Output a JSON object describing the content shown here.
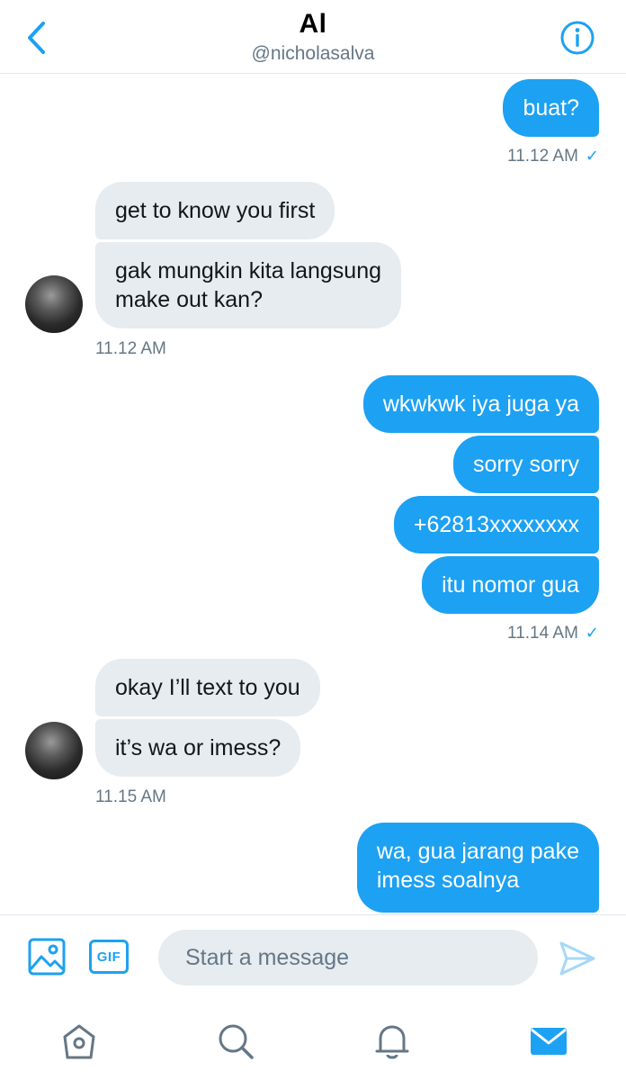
{
  "header": {
    "title": "Al",
    "handle": "@nicholasalva"
  },
  "messages": {
    "m1": "buat?",
    "ts1": "11.12 AM",
    "m2": "get to know you first",
    "m3_line1": "gak mungkin kita langsung",
    "m3_line2": "make out kan?",
    "ts2": "11.12 AM",
    "m4": "wkwkwk iya juga ya",
    "m5": "sorry sorry",
    "m6": "+62813xxxxxxxx",
    "m7": "itu nomor gua",
    "ts3": "11.14 AM",
    "m8": "okay I’ll text to you",
    "m9": "it’s wa or imess?",
    "ts4": "11.15 AM",
    "m10_line1": "wa, gua jarang pake",
    "m10_line2": "imess soalnya",
    "read_mark": "✓"
  },
  "composer": {
    "gif_label": "GIF",
    "placeholder": "Start a message"
  },
  "colors": {
    "accent": "#1da1f2",
    "incoming_bubble": "#e6ecf0",
    "secondary_text": "#657786"
  },
  "icons": {
    "back": "chevron-left-icon",
    "info": "info-icon",
    "media": "image-icon",
    "send": "send-icon",
    "home": "home-icon",
    "search": "search-icon",
    "notifications": "bell-icon",
    "messages": "mail-icon"
  }
}
